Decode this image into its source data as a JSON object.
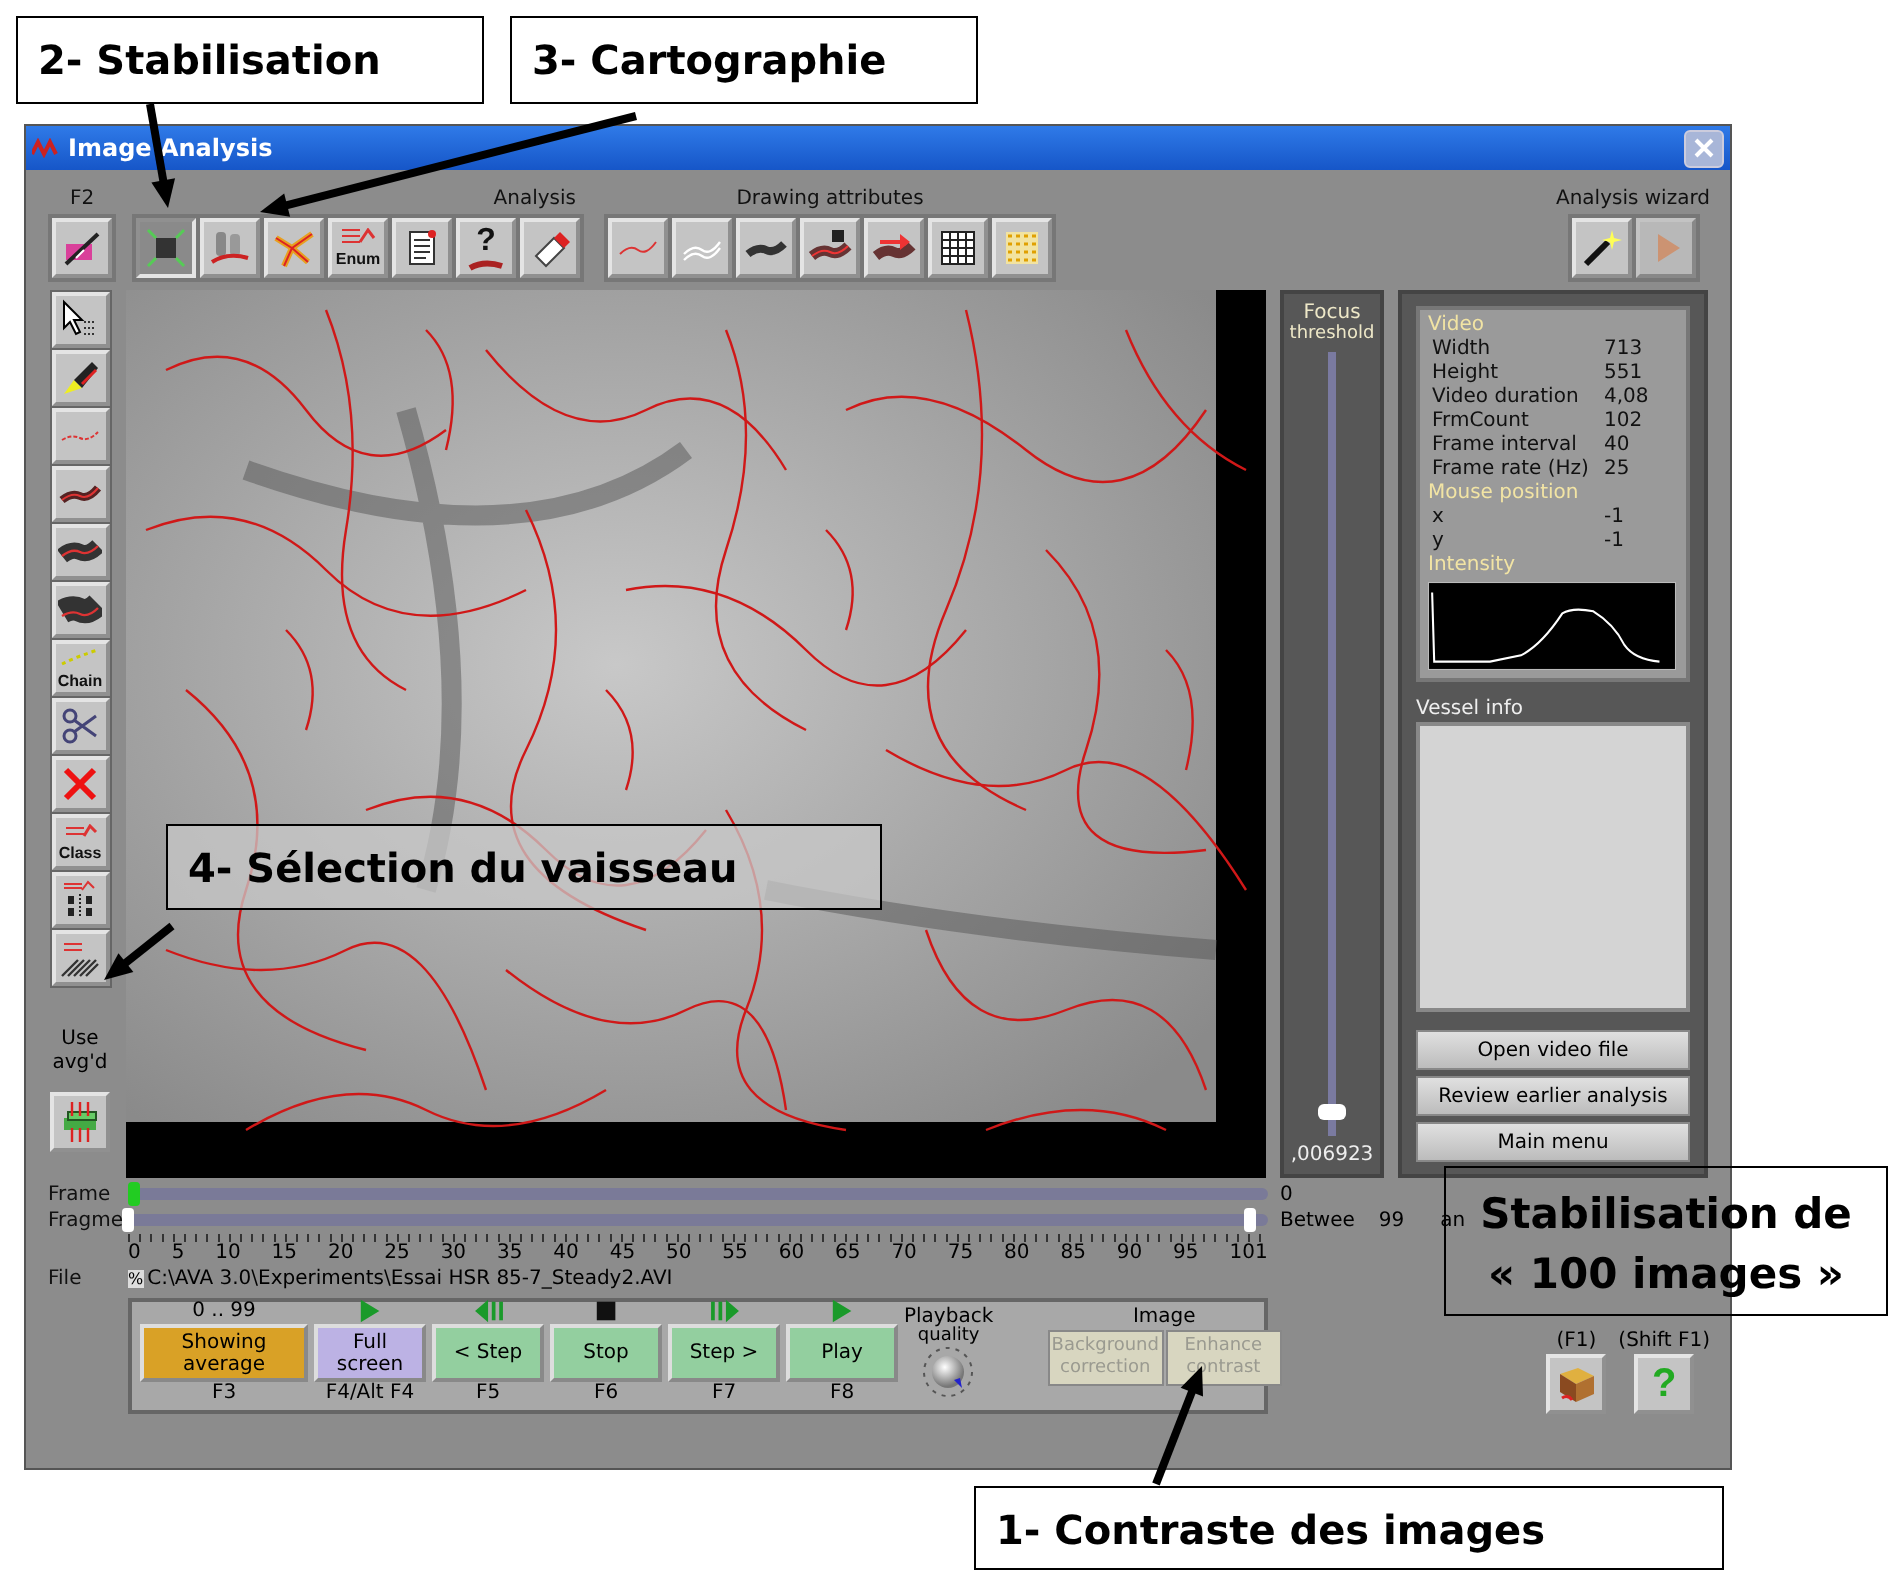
{
  "window": {
    "title": "Image Analysis"
  },
  "toolbar_groups": [
    {
      "label": "F2",
      "tools": [
        {
          "kind": "edit",
          "selected": false
        }
      ]
    },
    {
      "label": "Analysis",
      "tools": [
        {
          "kind": "stabilize",
          "selected": true
        },
        {
          "kind": "map",
          "selected": false
        },
        {
          "kind": "network",
          "selected": false
        },
        {
          "kind": "enum",
          "label": "Enum",
          "selected": false
        },
        {
          "kind": "document",
          "selected": false
        },
        {
          "kind": "help",
          "label": "?",
          "selected": false
        },
        {
          "kind": "eraser",
          "selected": false
        }
      ]
    },
    {
      "label": "Drawing attributes",
      "tools": [
        {
          "kind": "thin-line",
          "selected": false
        },
        {
          "kind": "double-line",
          "selected": false
        },
        {
          "kind": "thick-line",
          "selected": false
        },
        {
          "kind": "numbered-vessel",
          "selected": false
        },
        {
          "kind": "arrow-vessel",
          "selected": false
        },
        {
          "kind": "grid",
          "selected": false
        },
        {
          "kind": "dots",
          "selected": false
        }
      ]
    }
  ],
  "wizard": {
    "label": "Analysis wizard",
    "tools": [
      {
        "kind": "wand",
        "disabled": false
      },
      {
        "kind": "play",
        "disabled": true
      }
    ]
  },
  "side_tools": [
    {
      "kind": "pointer",
      "selected": false
    },
    {
      "kind": "pen",
      "selected": false
    },
    {
      "kind": "thin-trace",
      "selected": false
    },
    {
      "kind": "medium-trace",
      "selected": false
    },
    {
      "kind": "thick-trace",
      "selected": false
    },
    {
      "kind": "wide-trace",
      "selected": false
    },
    {
      "kind": "chain",
      "label": "Chain",
      "selected": false
    },
    {
      "kind": "scissors",
      "selected": false
    },
    {
      "kind": "delete",
      "selected": false
    },
    {
      "kind": "class",
      "label": "Class",
      "selected": false
    },
    {
      "kind": "numbering",
      "selected": false
    },
    {
      "kind": "hatch",
      "selected": false
    }
  ],
  "use_average": {
    "label": "Use avg'd"
  },
  "focus": {
    "label": "Focus",
    "sublabel": "threshold",
    "level": 0.02,
    "reading": ",006923"
  },
  "video_info": {
    "heading": "Video",
    "rows": [
      {
        "label": "Width",
        "value": "713"
      },
      {
        "label": "Height",
        "value": "551"
      },
      {
        "label": "Video duration",
        "value": "4,08"
      },
      {
        "label": "FrmCount",
        "value": "102"
      },
      {
        "label": "Frame interval",
        "value": "40"
      },
      {
        "label": "Frame rate (Hz)",
        "value": "25"
      }
    ],
    "mouse_heading": "Mouse position",
    "mouse_rows": [
      {
        "label": "x",
        "value": "-1"
      },
      {
        "label": "y",
        "value": "-1"
      }
    ],
    "intensity_label": "Intensity"
  },
  "vessel_info": {
    "label": "Vessel info"
  },
  "side_buttons": [
    "Open video file",
    "Review earlier analysis",
    "Main menu"
  ],
  "frame_slider": {
    "label": "Frame",
    "level": 0,
    "reading": "0"
  },
  "fragment_slider": {
    "label": "Fragme",
    "thumbs": [
      {
        "level": 0
      },
      {
        "level": 0.985
      }
    ],
    "reading_label": "Betwee",
    "reading": "99",
    "unit": "an"
  },
  "scale": [
    "0",
    "5",
    "10",
    "15",
    "20",
    "25",
    "30",
    "35",
    "40",
    "45",
    "50",
    "55",
    "60",
    "65",
    "70",
    "75",
    "80",
    "85",
    "90",
    "95",
    "101"
  ],
  "file": {
    "label": "File",
    "prefix": "%",
    "path": "C:\\AVA 3.0\\Experiments\\Essai HSR 85-7_Steady2.AVI"
  },
  "playback": {
    "range": "0 .. 99",
    "buttons": [
      {
        "kind": "average",
        "label": "Showing average",
        "key": "F3",
        "color": "#d9a126"
      },
      {
        "kind": "play",
        "label": "Full screen",
        "key": "F4/Alt F4",
        "color": "#bcb2e4"
      },
      {
        "kind": "step-back",
        "label": "< Step",
        "key": "F5",
        "color": "#93cf9f"
      },
      {
        "kind": "stop",
        "label": "Stop",
        "key": "F6",
        "color": "#93cf9f"
      },
      {
        "kind": "step-forward",
        "label": "Step >",
        "key": "F7",
        "color": "#93cf9f"
      },
      {
        "kind": "play",
        "label": "Play",
        "key": "F8",
        "color": "#93cf9f"
      }
    ],
    "quality_label": "Playback",
    "quality_sublabel": "quality"
  },
  "image_group": {
    "label": "Image",
    "buttons": [
      {
        "label": "Background correction",
        "disabled": true
      },
      {
        "label": "Enhance contrast",
        "disabled": true
      }
    ]
  },
  "help": [
    {
      "key": "(F1)",
      "kind": "book"
    },
    {
      "key": "(Shift F1)",
      "kind": "question",
      "label": "?"
    }
  ],
  "annotations": [
    {
      "kind": "stabilisation",
      "lines": [
        "2- Stabilisation"
      ]
    },
    {
      "kind": "cartographie",
      "lines": [
        "3- Cartographie"
      ]
    },
    {
      "kind": "selection",
      "lines": [
        "4- Sélection du vaisseau"
      ]
    },
    {
      "kind": "frames",
      "lines": [
        "Stabilisation de",
        "« 100 images »"
      ]
    },
    {
      "kind": "contrast",
      "lines": [
        "1- Contraste des images"
      ]
    }
  ]
}
